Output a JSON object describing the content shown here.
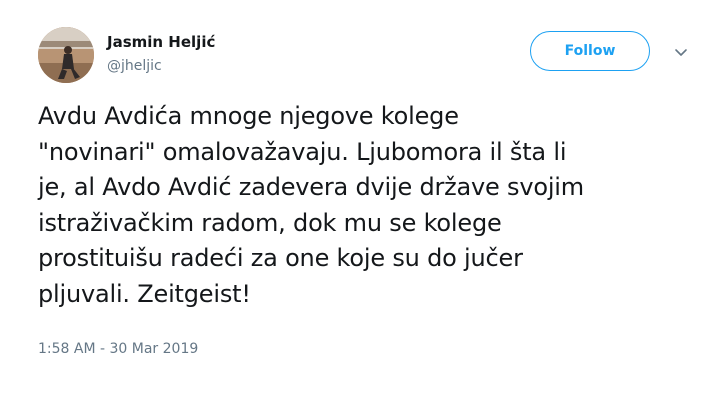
{
  "user": {
    "display_name": "Jasmin Heljić",
    "handle": "@jheljic",
    "avatar_icon": "profile-photo"
  },
  "actions": {
    "follow_label": "Follow",
    "more_icon": "chevron-down-icon"
  },
  "tweet": {
    "text": "Avdu Avdića mnoge njegove kolege\n\"novinari\" omalovažavaju. Ljubomora il šta li\nje, al Avdo Avdić zadevera dvije države svojim\nistraživačkim radom, dok mu se kolege\nprostituišu radeći za one koje su do jučer\npljuvali. Zeitgeist!",
    "timestamp": "1:58 AM - 30 Mar 2019"
  },
  "colors": {
    "accent": "#1da1f2",
    "text_primary": "#14171a",
    "text_secondary": "#657786"
  }
}
